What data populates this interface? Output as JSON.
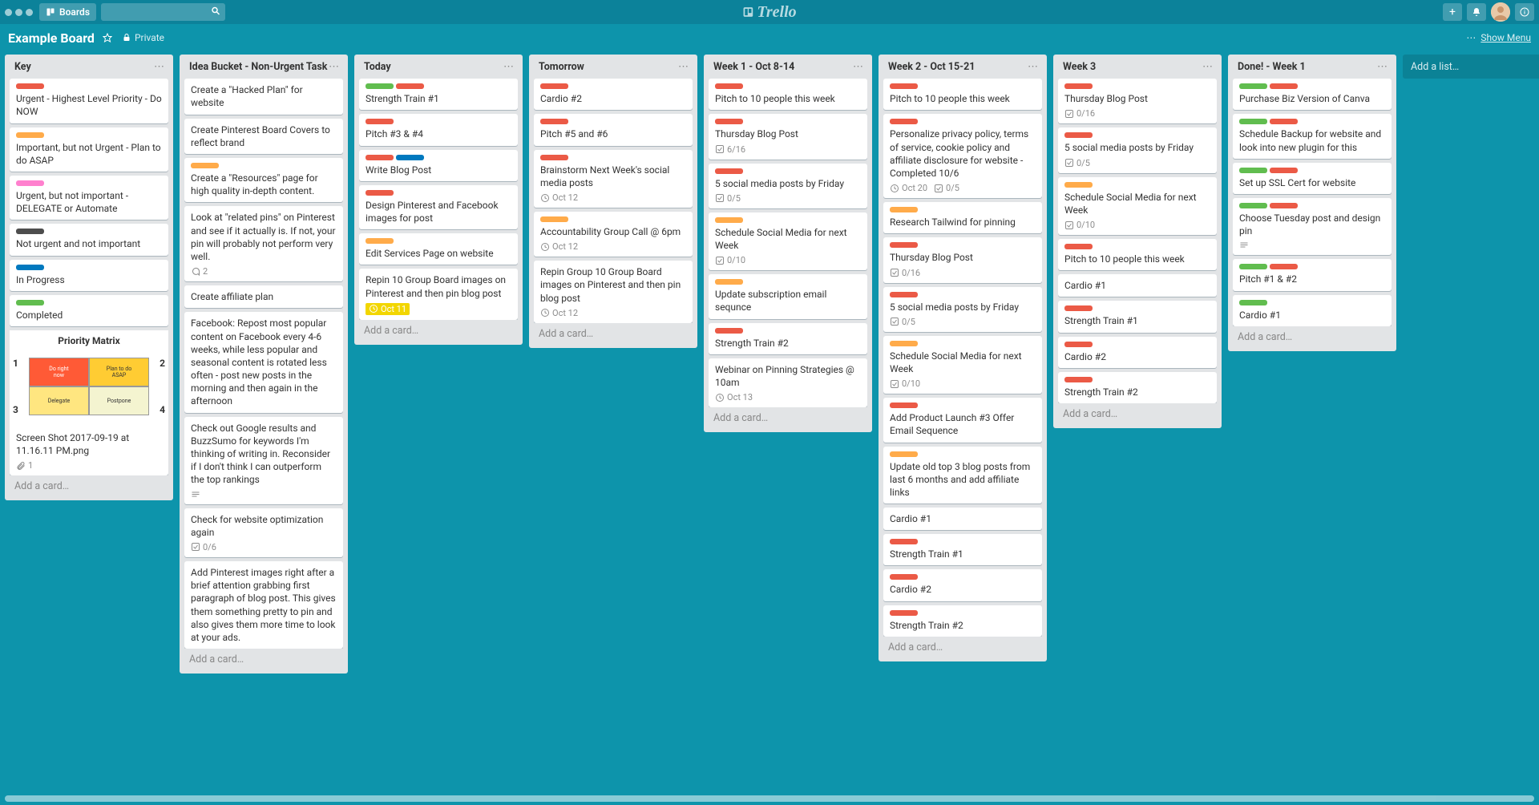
{
  "header": {
    "boards_label": "Boards",
    "logo_text": "Trello",
    "show_menu": "Show Menu"
  },
  "board": {
    "title": "Example Board",
    "privacy": "Private",
    "add_list": "Add a list…",
    "add_card": "Add a card…"
  },
  "lists": [
    {
      "title": "Key",
      "cards": [
        {
          "labels": [
            "red"
          ],
          "title": "Urgent - Highest Level Priority - Do NOW"
        },
        {
          "labels": [
            "orange"
          ],
          "title": "Important, but not Urgent - Plan to do ASAP"
        },
        {
          "labels": [
            "pink"
          ],
          "title": "Urgent, but not important - DELEGATE or Automate"
        },
        {
          "labels": [
            "black"
          ],
          "title": "Not urgent and not important"
        },
        {
          "labels": [
            "blue"
          ],
          "title": "In Progress"
        },
        {
          "labels": [
            "green"
          ],
          "title": "Completed"
        },
        {
          "type": "image",
          "matrix_title": "Priority Matrix",
          "title": "Screen Shot 2017-09-19 at 11.16.11 PM.png",
          "attachments": "1"
        }
      ]
    },
    {
      "title": "Idea Bucket - Non-Urgent Task",
      "cards": [
        {
          "title": "Create a \"Hacked Plan\" for website"
        },
        {
          "title": "Create Pinterest Board Covers to reflect brand"
        },
        {
          "labels": [
            "orange"
          ],
          "title": "Create a \"Resources\" page for high quality in-depth content."
        },
        {
          "title": "Look at \"related pins\" on Pinterest and see if it actually is. If not, your pin will probably not perform very well.",
          "comments": "2"
        },
        {
          "title": "Create affiliate plan"
        },
        {
          "title": "Facebook: Repost most popular content on Facebook every 4-6 weeks, while less popular and seasonal content is rotated less often - post new posts in the morning and then again in the afternoon"
        },
        {
          "title": "Check out Google results and BuzzSumo for keywords I'm thinking of writing in. Reconsider if I don't think I can outperform the top rankings",
          "desc": true
        },
        {
          "title": "Check for website optimization again",
          "checklist": "0/6"
        },
        {
          "title": "Add Pinterest images right after a brief attention grabbing first paragraph of blog post. This gives them something pretty to pin and also gives them more time to look at your ads."
        }
      ]
    },
    {
      "title": "Today",
      "cards": [
        {
          "labels": [
            "green",
            "red"
          ],
          "title": "Strength Train #1"
        },
        {
          "labels": [
            "red"
          ],
          "title": "Pitch #3 & #4"
        },
        {
          "labels": [
            "red",
            "blue"
          ],
          "title": "Write Blog Post"
        },
        {
          "labels": [
            "red"
          ],
          "title": "Design Pinterest and Facebook images for post"
        },
        {
          "labels": [
            "orange"
          ],
          "title": "Edit Services Page on website"
        },
        {
          "title": "Repin 10 Group Board images on Pinterest and then pin blog post",
          "due": "Oct 11",
          "due_color": "yellow"
        }
      ]
    },
    {
      "title": "Tomorrow",
      "cards": [
        {
          "labels": [
            "red"
          ],
          "title": "Cardio #2"
        },
        {
          "labels": [
            "red"
          ],
          "title": "Pitch #5 and #6"
        },
        {
          "labels": [
            "red"
          ],
          "title": "Brainstorm Next Week's social media posts",
          "due": "Oct 12"
        },
        {
          "labels": [
            "orange"
          ],
          "title": "Accountability Group Call @ 6pm",
          "due": "Oct 12"
        },
        {
          "title": "Repin Group 10 Group Board images on Pinterest and then pin blog post",
          "due": "Oct 12"
        }
      ]
    },
    {
      "title": "Week 1 - Oct 8-14",
      "cards": [
        {
          "labels": [
            "red"
          ],
          "title": "Pitch to 10 people this week"
        },
        {
          "labels": [
            "red"
          ],
          "title": "Thursday Blog Post",
          "checklist": "6/16"
        },
        {
          "labels": [
            "red"
          ],
          "title": "5 social media posts by Friday",
          "checklist": "0/5"
        },
        {
          "labels": [
            "orange"
          ],
          "title": "Schedule Social Media for next Week",
          "checklist": "0/10"
        },
        {
          "labels": [
            "orange"
          ],
          "title": "Update subscription email sequnce"
        },
        {
          "labels": [
            "red"
          ],
          "title": "Strength Train #2"
        },
        {
          "title": "Webinar on Pinning Strategies @ 10am",
          "due": "Oct 13"
        }
      ]
    },
    {
      "title": "Week 2 - Oct 15-21",
      "cards": [
        {
          "labels": [
            "red"
          ],
          "title": "Pitch to 10 people this week"
        },
        {
          "labels": [
            "red"
          ],
          "title": "Personalize privacy policy, terms of service, cookie policy and affiliate disclosure for website - Completed 10/6",
          "due": "Oct 20",
          "checklist": "0/5"
        },
        {
          "labels": [
            "orange"
          ],
          "title": "Research Tailwind for pinning"
        },
        {
          "labels": [
            "red"
          ],
          "title": "Thursday Blog Post",
          "checklist": "0/16"
        },
        {
          "labels": [
            "red"
          ],
          "title": "5 social media posts by Friday",
          "checklist": "0/5"
        },
        {
          "labels": [
            "orange"
          ],
          "title": "Schedule Social Media for next Week",
          "checklist": "0/10"
        },
        {
          "labels": [
            "red"
          ],
          "title": "Add Product Launch #3 Offer Email Sequence"
        },
        {
          "labels": [
            "orange"
          ],
          "title": "Update old top 3 blog posts from last 6 months and add affiliate links"
        },
        {
          "title": "Cardio #1"
        },
        {
          "labels": [
            "red"
          ],
          "title": "Strength Train #1"
        },
        {
          "labels": [
            "red"
          ],
          "title": "Cardio #2"
        },
        {
          "labels": [
            "red"
          ],
          "title": "Strength Train #2"
        }
      ]
    },
    {
      "title": "Week 3",
      "cards": [
        {
          "labels": [
            "red"
          ],
          "title": "Thursday Blog Post",
          "checklist": "0/16"
        },
        {
          "labels": [
            "red"
          ],
          "title": "5 social media posts by Friday",
          "checklist": "0/5"
        },
        {
          "labels": [
            "orange"
          ],
          "title": "Schedule Social Media for next Week",
          "checklist": "0/10"
        },
        {
          "labels": [
            "red"
          ],
          "title": "Pitch to 10 people this week"
        },
        {
          "title": "Cardio #1"
        },
        {
          "labels": [
            "red"
          ],
          "title": "Strength Train #1"
        },
        {
          "labels": [
            "red"
          ],
          "title": "Cardio #2"
        },
        {
          "labels": [
            "red"
          ],
          "title": "Strength Train #2"
        }
      ]
    },
    {
      "title": "Done! - Week 1",
      "cards": [
        {
          "labels": [
            "green",
            "red"
          ],
          "title": "Purchase Biz Version of Canva"
        },
        {
          "labels": [
            "green",
            "red"
          ],
          "title": "Schedule Backup for website and look into new plugin for this"
        },
        {
          "labels": [
            "green",
            "red"
          ],
          "title": "Set up SSL Cert for website"
        },
        {
          "labels": [
            "green",
            "red"
          ],
          "title": "Choose Tuesday post and design pin",
          "desc": true
        },
        {
          "labels": [
            "green",
            "red"
          ],
          "title": "Pitch #1 & #2"
        },
        {
          "labels": [
            "green"
          ],
          "title": "Cardio #1"
        }
      ]
    }
  ]
}
